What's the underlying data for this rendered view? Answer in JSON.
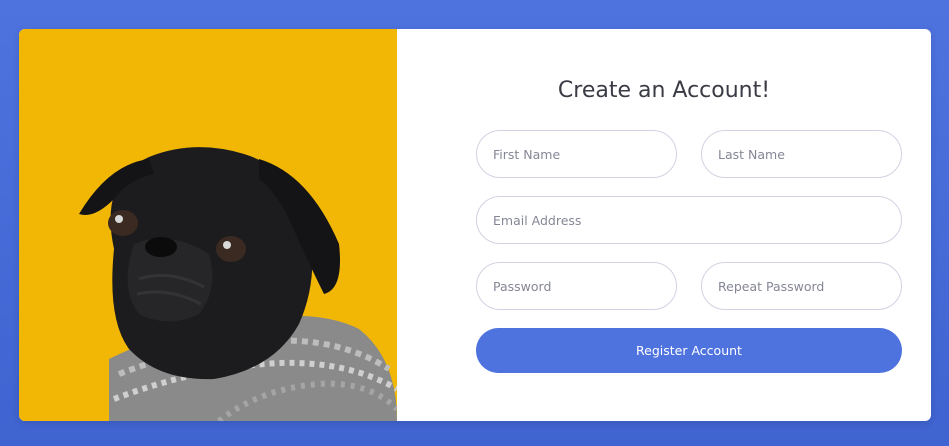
{
  "form": {
    "title": "Create an Account!",
    "first_name_placeholder": "First Name",
    "last_name_placeholder": "Last Name",
    "email_placeholder": "Email Address",
    "password_placeholder": "Password",
    "repeat_password_placeholder": "Repeat Password",
    "register_label": "Register Account"
  },
  "colors": {
    "page_background": "#4e73df",
    "image_background": "#f2b705",
    "button": "#4e73df"
  },
  "icons": {
    "illustration": "pug-dog-photo"
  }
}
